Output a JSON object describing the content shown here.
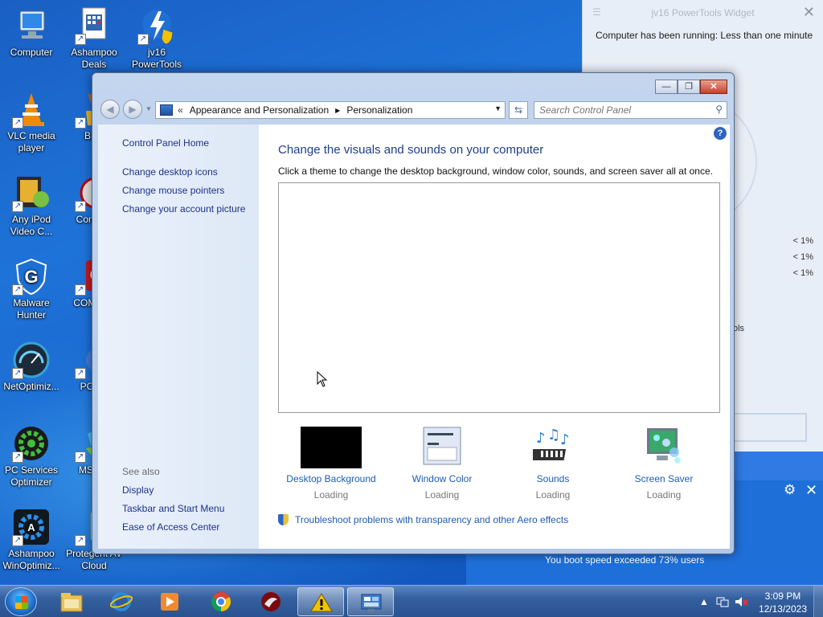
{
  "desktop": {
    "icons": [
      {
        "label": "Computer",
        "icon": "computer-icon"
      },
      {
        "label": "Ashampoo Deals",
        "icon": "ashampoo-deals-icon"
      },
      {
        "label": "jv16 PowerTools",
        "icon": "jv16-powertools-icon"
      },
      {
        "label": "VLC media player",
        "icon": "vlc-icon"
      },
      {
        "label": "Blea",
        "icon": "bleachbit-icon"
      },
      {
        "label": "Any iPod Video C...",
        "icon": "any-ipod-video-converter-icon"
      },
      {
        "label": "Con Dra",
        "icon": "context-drag-icon"
      },
      {
        "label": "Malware Hunter",
        "icon": "malware-hunter-icon"
      },
      {
        "label": "COM Anti",
        "icon": "comodo-antivirus-icon"
      },
      {
        "label": "NetOptimiz...",
        "icon": "netoptimizer-icon"
      },
      {
        "label": "PC Bo",
        "icon": "pc-booster-icon"
      },
      {
        "label": "PC Services Optimizer",
        "icon": "pc-services-optimizer-icon"
      },
      {
        "label": "MSN E",
        "icon": "msn-explorer-icon"
      },
      {
        "label": "Ashampoo WinOptimiz...",
        "icon": "ashampoo-winoptimizer-icon"
      },
      {
        "label": "Protegent AV Cloud",
        "icon": "protegent-av-icon"
      }
    ]
  },
  "widget": {
    "title": "jv16 PowerTools Widget",
    "running_text": "Computer has been running: Less than one minute",
    "percentages": [
      "< 1%",
      "< 1%",
      "< 1%"
    ],
    "tools_fragment": "ols",
    "boost_text": "You boot speed exceeded 73% users"
  },
  "window": {
    "controls": {
      "minimize": "—",
      "maximize": "❐",
      "close": "✕"
    },
    "breadcrumb": {
      "prefix": "«",
      "items": [
        "Appearance and Personalization",
        "Personalization"
      ],
      "separator": "▶"
    },
    "search": {
      "placeholder": "Search Control Panel"
    },
    "sidebar": {
      "home": "Control Panel Home",
      "links": [
        "Change desktop icons",
        "Change mouse pointers",
        "Change your account picture"
      ],
      "see_also_label": "See also",
      "see_also": [
        "Display",
        "Taskbar and Start Menu",
        "Ease of Access Center"
      ]
    },
    "main": {
      "title": "Change the visuals and sounds on your computer",
      "description": "Click a theme to change the desktop background, window color, sounds, and screen saver all at once.",
      "options": [
        {
          "label": "Desktop Background",
          "status": "Loading",
          "icon": "desktop-background-icon"
        },
        {
          "label": "Window Color",
          "status": "Loading",
          "icon": "window-color-icon"
        },
        {
          "label": "Sounds",
          "status": "Loading",
          "icon": "sounds-icon"
        },
        {
          "label": "Screen Saver",
          "status": "Loading",
          "icon": "screen-saver-icon"
        }
      ],
      "troubleshoot_link": "Troubleshoot problems with transparency and other Aero effects"
    }
  },
  "taskbar": {
    "items": [
      "file-explorer-icon",
      "internet-explorer-icon",
      "media-player-icon",
      "chrome-icon",
      "comodo-dragon-icon",
      "warning-app-icon",
      "control-panel-icon"
    ],
    "clock": {
      "time": "3:09 PM",
      "date": "12/13/2023"
    }
  }
}
